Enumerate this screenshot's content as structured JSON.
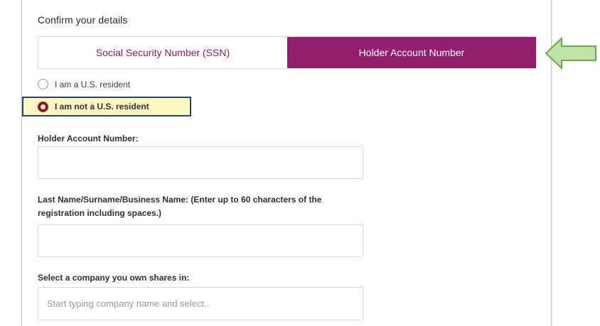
{
  "form": {
    "heading": "Confirm your details",
    "tabs": [
      {
        "label": "Social Security Number (SSN)",
        "active": false
      },
      {
        "label": "Holder Account Number",
        "active": true
      }
    ],
    "residency": {
      "options": [
        {
          "label": "I am a U.S. resident",
          "checked": false
        },
        {
          "label": "I am not a U.S. resident",
          "checked": true
        }
      ]
    },
    "holder_account_label": "Holder Account Number:",
    "holder_account_value": "",
    "last_name_label": "Last Name/Surname/Business Name: (Enter up to 60 characters of the registration including spaces.)",
    "last_name_value": "",
    "company_label": "Select a company you own shares in:",
    "company_placeholder": "Start typing company name and select.."
  },
  "colors": {
    "brand": "#931d6f",
    "highlight_fill": "#fff7c4",
    "highlight_border": "#27456b",
    "arrow_fill": "#bfe3a6",
    "arrow_stroke": "#6aa84f"
  },
  "icons": {
    "annotation": "arrow-left-icon"
  }
}
